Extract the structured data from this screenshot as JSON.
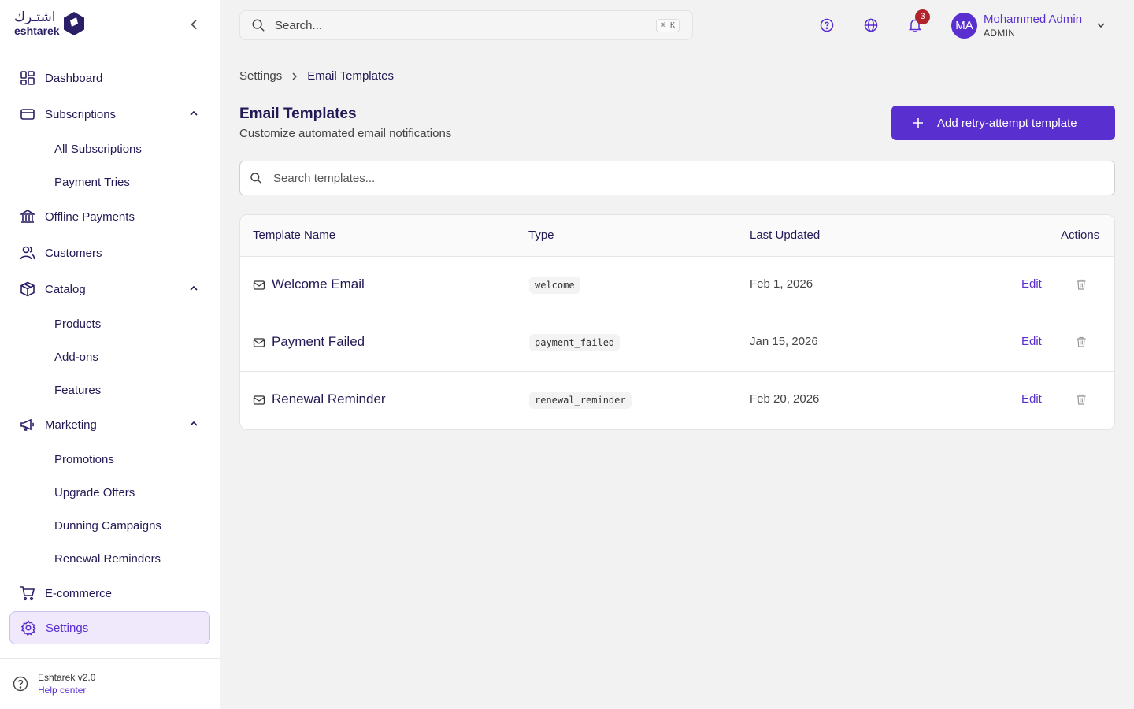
{
  "brand": {
    "name_ar": "اشتـرك",
    "name_en": "eshtarek"
  },
  "sidebar": {
    "items": [
      {
        "label": "Dashboard",
        "icon": "dashboard-icon"
      },
      {
        "label": "Subscriptions",
        "icon": "card-icon",
        "expanded": true,
        "children": [
          "All Subscriptions",
          "Payment Tries"
        ]
      },
      {
        "label": "Offline Payments",
        "icon": "bank-icon"
      },
      {
        "label": "Customers",
        "icon": "users-icon"
      },
      {
        "label": "Catalog",
        "icon": "box-icon",
        "expanded": true,
        "children": [
          "Products",
          "Add-ons",
          "Features"
        ]
      },
      {
        "label": "Marketing",
        "icon": "megaphone-icon",
        "expanded": true,
        "children": [
          "Promotions",
          "Upgrade Offers",
          "Dunning Campaigns",
          "Renewal Reminders"
        ]
      },
      {
        "label": "E-commerce",
        "icon": "cart-icon"
      },
      {
        "label": "Settings",
        "icon": "gear-icon",
        "active": true
      }
    ],
    "footer": {
      "version": "Eshtarek v2.0",
      "help": "Help center"
    }
  },
  "topbar": {
    "search_placeholder": "Search...",
    "shortcut": "⌘ K",
    "notifications_count": "3",
    "user": {
      "initials": "MA",
      "name": "Mohammed Admin",
      "role": "ADMIN"
    }
  },
  "breadcrumb": {
    "parent": "Settings",
    "current": "Email Templates"
  },
  "page": {
    "title": "Email Templates",
    "subtitle": "Customize automated email notifications",
    "add_button": "Add retry-attempt template",
    "search_placeholder": "Search templates..."
  },
  "table": {
    "headers": {
      "name": "Template Name",
      "type": "Type",
      "updated": "Last Updated",
      "actions": "Actions"
    },
    "edit_label": "Edit",
    "rows": [
      {
        "name": "Welcome Email",
        "type": "welcome",
        "updated": "Feb 1, 2026"
      },
      {
        "name": "Payment Failed",
        "type": "payment_failed",
        "updated": "Jan 15, 2026"
      },
      {
        "name": "Renewal Reminder",
        "type": "renewal_reminder",
        "updated": "Feb 20, 2026"
      }
    ]
  },
  "colors": {
    "accent": "#5a2fd0",
    "brand_dark": "#231a55",
    "badge": "#b1222a",
    "active_bg": "#efe9fb"
  }
}
